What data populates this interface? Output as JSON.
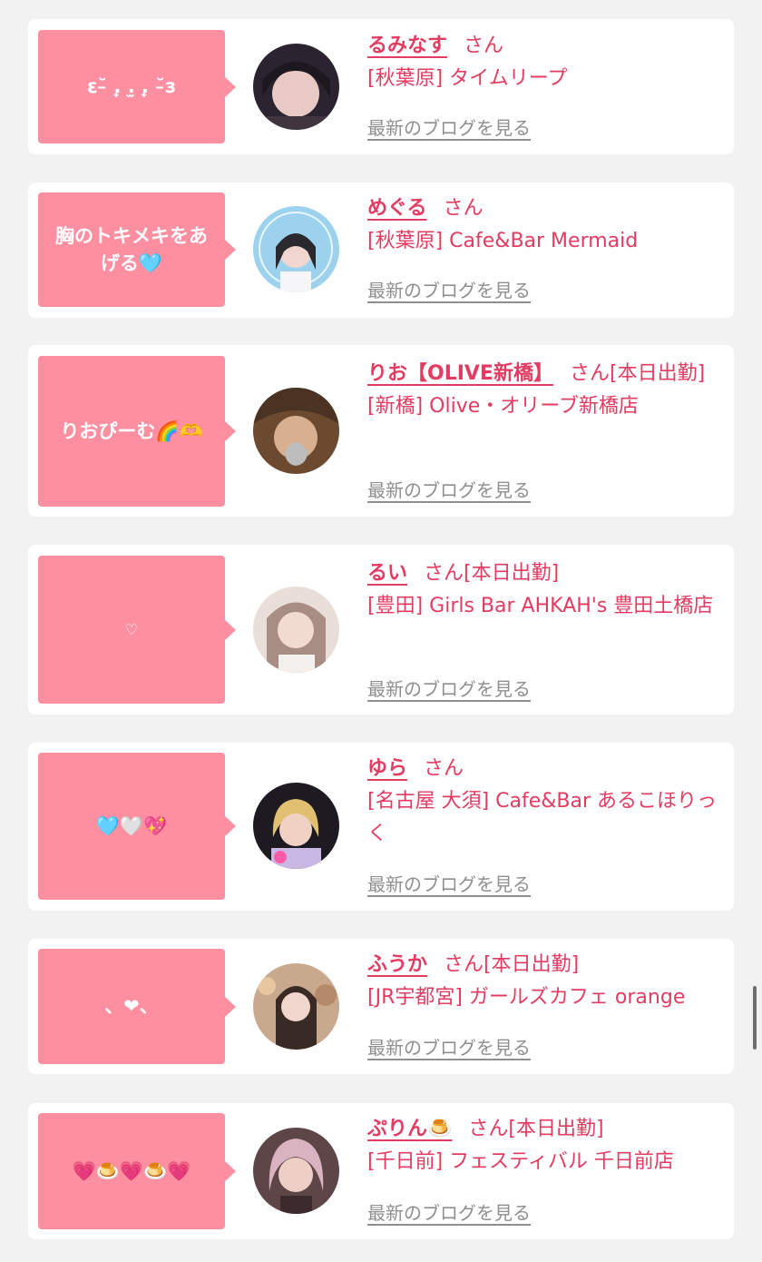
{
  "blog_link_label": "最新のブログを見る",
  "honorific": "さん",
  "cast": [
    {
      "message": "ε˘̵ .̟ .̫ .̟ ˘̵з",
      "name": "るみなす",
      "status": "",
      "shop": "[秋葉原] タイムリープ",
      "avatar_colors": [
        "#2b2430",
        "#d8b4b0"
      ]
    },
    {
      "message": "胸のトキメキをあげる🩵",
      "name": "めぐる",
      "status": "",
      "shop": "[秋葉原] Cafe&Bar Mermaid",
      "avatar_colors": [
        "#9cd2ee",
        "#2a2a2e"
      ]
    },
    {
      "message": "りおぴーむ🌈🫶",
      "name": "りお【OLIVE新橋】",
      "status": "[本日出勤]",
      "shop": "[新橋] Olive・オリーブ新橋店",
      "avatar_colors": [
        "#6b4a30",
        "#bdbdbd"
      ]
    },
    {
      "message": "♡",
      "name": "るい",
      "status": "[本日出勤]",
      "shop": "[豊田] Girls Bar AHKAH's 豊田土橋店",
      "avatar_colors": [
        "#e9ded8",
        "#a78d84"
      ]
    },
    {
      "message": "🩵🤍💖",
      "name": "ゆら",
      "status": "",
      "shop": "[名古屋 大須] Cafe&Bar あるこほりっく",
      "avatar_colors": [
        "#1e1a22",
        "#e0c070"
      ]
    },
    {
      "message": "、❤︎、",
      "name": "ふうか",
      "status": "[本日出勤]",
      "shop": "[JR宇都宮] ガールズカフェ orange",
      "avatar_colors": [
        "#c9a98e",
        "#3a2a26"
      ]
    },
    {
      "message": "💗🍮💗🍮💗",
      "name": "ぷりん🍮",
      "status": "[本日出勤]",
      "shop": "[千日前] フェスティバル 千日前店",
      "avatar_colors": [
        "#5e4548",
        "#d9b3c0"
      ]
    }
  ]
}
